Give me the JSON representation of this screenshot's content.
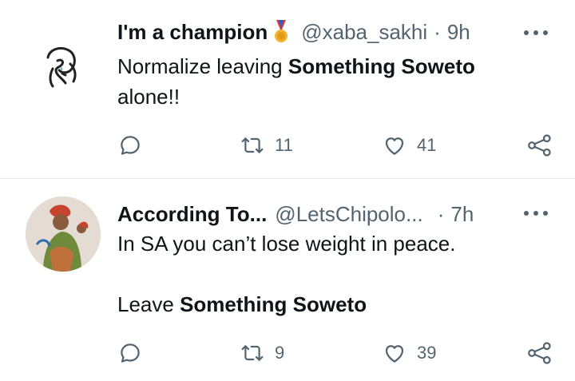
{
  "tweets": [
    {
      "name": "I'm a champion",
      "badge_icon": "medal-icon",
      "handle": "@xaba_sakhi",
      "separator": "·",
      "time": "9h",
      "text_plain": "Normalize leaving ",
      "text_bold": "Something Soweto",
      "text_after": "alone!!",
      "replies": "",
      "retweets": "11",
      "likes": "41"
    },
    {
      "name": "According To...",
      "handle": "@LetsChipolo...",
      "separator": "·",
      "time": "7h",
      "line1": "In SA you can’t lose weight in peace.",
      "line3_plain": "Leave ",
      "line3_bold": "Something Soweto",
      "replies": "",
      "retweets": "9",
      "likes": "39"
    }
  ],
  "colors": {
    "text": "#0f1419",
    "secondary": "#536471",
    "divider": "#e7e7e7"
  }
}
